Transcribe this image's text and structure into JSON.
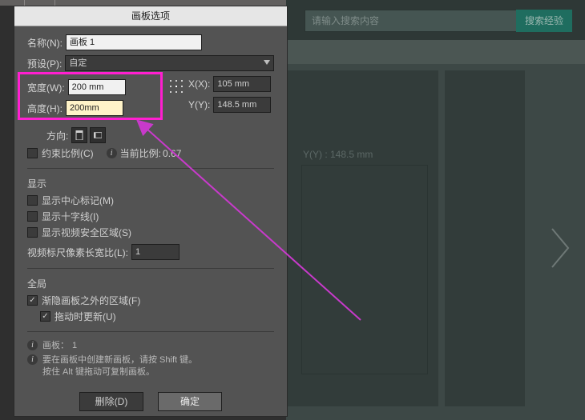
{
  "bg": {
    "search_placeholder": "请输入搜索内容",
    "search_btn": "搜索经验",
    "ghost_y": "Y(Y) : 148.5 mm"
  },
  "dialog": {
    "title": "画板选项",
    "name_label": "名称(N):",
    "name_value": "画板 1",
    "preset_label": "预设(P):",
    "preset_value": "自定",
    "width_label": "宽度(W):",
    "width_value": "200 mm",
    "height_label": "高度(H):",
    "height_value": "200mm",
    "x_label": "X(X):",
    "x_value": "105 mm",
    "y_label": "Y(Y):",
    "y_value": "148.5 mm",
    "orient_label": "方向:",
    "constrain_label": "约束比例(C)",
    "ratio_label": "当前比例:",
    "ratio_value": "0.67",
    "display_title": "显示",
    "show_center": "显示中心标记(M)",
    "show_cross": "显示十字线(I)",
    "show_safe": "显示视频安全区域(S)",
    "video_px_ratio_label": "视频标尺像素长宽比(L):",
    "video_px_ratio_value": "1",
    "global_title": "全局",
    "fade_outside": "渐隐画板之外的区域(F)",
    "update_drag": "拖动时更新(U)",
    "info_count_label": "画板：",
    "info_count_value": "1",
    "info_hint_line1": "要在画板中创建新画板，请按 Shift 键。",
    "info_hint_line2": "按住 Alt 键拖动可复制画板。",
    "btn_delete": "删除(D)",
    "btn_ok": "确定"
  }
}
